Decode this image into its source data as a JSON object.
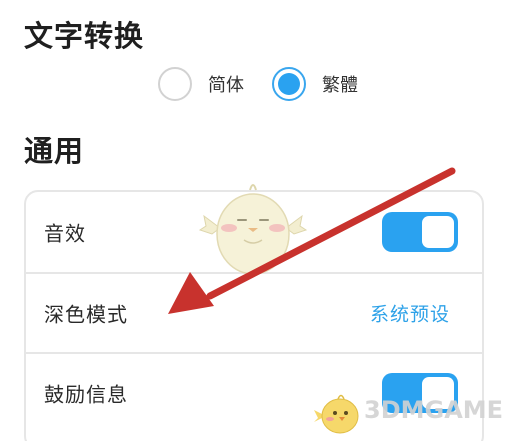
{
  "text_conversion": {
    "title": "文字转换",
    "options": [
      {
        "label": "简体",
        "checked": false
      },
      {
        "label": "繁體",
        "checked": true
      }
    ]
  },
  "general": {
    "title": "通用",
    "rows": [
      {
        "label": "音效",
        "control": "toggle",
        "on": true
      },
      {
        "label": "深色模式",
        "control": "value",
        "value": "系统预设"
      },
      {
        "label": "鼓励信息",
        "control": "toggle",
        "on": true
      }
    ]
  },
  "watermark": {
    "text": "3DMGAME"
  },
  "colors": {
    "accent": "#2aa2f0",
    "arrow": "#c8322d",
    "value_text": "#2ea2e8"
  }
}
